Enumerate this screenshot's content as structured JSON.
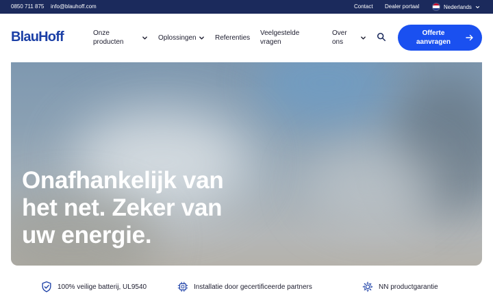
{
  "topbar": {
    "phone": "0850 711 875",
    "email": "info@blauhoff.com",
    "contact": "Contact",
    "dealer": "Dealer portaal",
    "language": "Nederlands",
    "flag_colors": [
      "#c8102e",
      "#ffffff",
      "#1e3a8a"
    ]
  },
  "nav": {
    "logo": "BlauHoff",
    "items": [
      {
        "line1": "Onze",
        "line2": "producten",
        "icon": "chevron-down-icon"
      },
      {
        "line1": "Oplossingen",
        "line2": "",
        "icon": "chevron-down-icon"
      },
      {
        "line1": "Referenties",
        "line2": ""
      },
      {
        "line1": "Veelgestelde",
        "line2": "vragen"
      },
      {
        "line1": "Over",
        "line2": "ons",
        "icon": "chevron-down-icon"
      }
    ],
    "search_icon": "search-icon",
    "cta": {
      "line1": "Offerte",
      "line2": "aanvragen",
      "icon": "arrow-right-icon"
    },
    "brand_color": "#1b3fa6",
    "accent": "#1a50f0",
    "topbar_bg": "#1b2a5c"
  },
  "hero": {
    "title_line1": "Onafhankelijk van",
    "title_line2": "het net. Zeker van",
    "title_line3": "uw energie."
  },
  "usps": [
    {
      "icon": "shield-check-icon",
      "text": "100% veilige batterij, UL9540"
    },
    {
      "icon": "chip-icon",
      "text": "Installatie door gecertificeerde partners"
    },
    {
      "icon": "gear-icon",
      "text": "NN productgarantie"
    }
  ]
}
